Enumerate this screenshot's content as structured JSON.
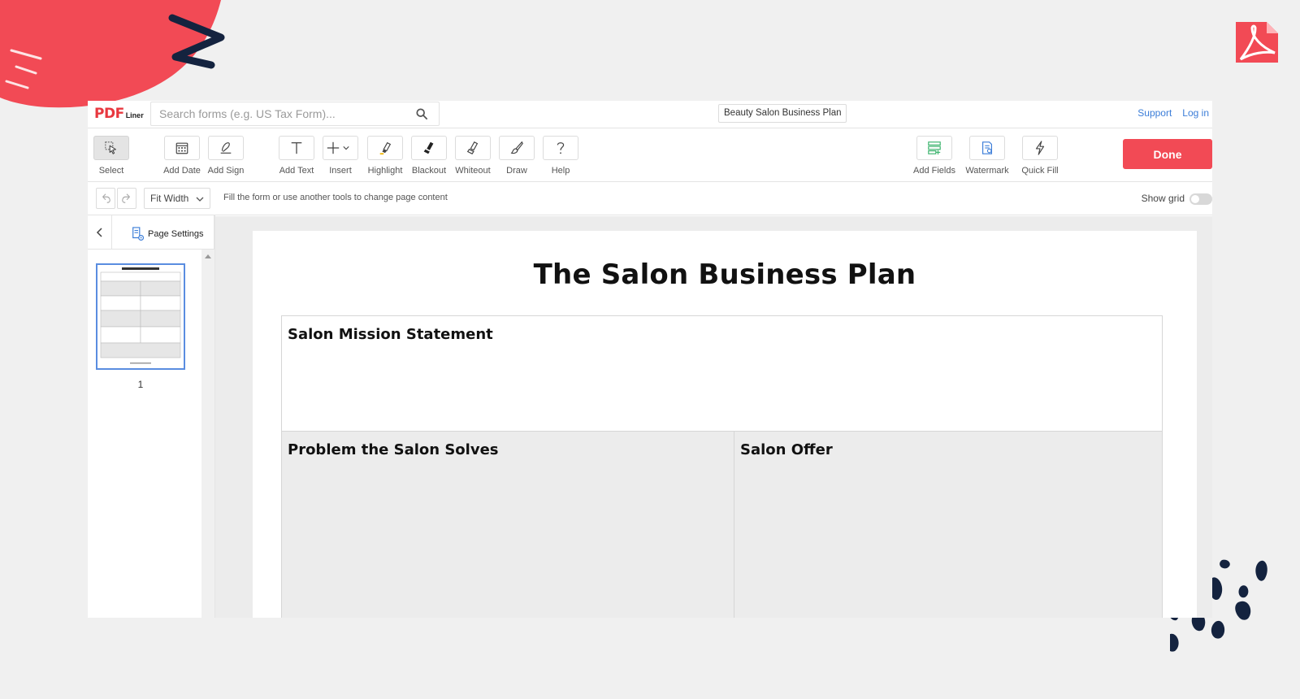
{
  "brand": {
    "logo_main": "PDF",
    "logo_sub": "Liner",
    "accent": "#f24a55",
    "link_color": "#3b7dd8"
  },
  "topbar": {
    "search_placeholder": "Search forms (e.g. US Tax Form)...",
    "doc_title": "Beauty Salon Business Plan",
    "support": "Support",
    "login": "Log in"
  },
  "toolbar": {
    "select": "Select",
    "add_date": "Add Date",
    "add_sign": "Add Sign",
    "add_text": "Add Text",
    "insert": "Insert",
    "highlight": "Highlight",
    "blackout": "Blackout",
    "whiteout": "Whiteout",
    "draw": "Draw",
    "help": "Help",
    "add_fields": "Add Fields",
    "watermark": "Watermark",
    "quick_fill": "Quick Fill",
    "done": "Done"
  },
  "subbar": {
    "zoom": "Fit Width",
    "hint": "Fill the form or use another tools to change page content",
    "show_grid": "Show grid"
  },
  "sidebar": {
    "page_settings": "Page Settings",
    "page_number": "1"
  },
  "document": {
    "title": "The Salon Business Plan",
    "sections": {
      "mission": "Salon Mission Statement",
      "problem": "Problem the Salon Solves",
      "offer": "Salon Offer"
    }
  }
}
